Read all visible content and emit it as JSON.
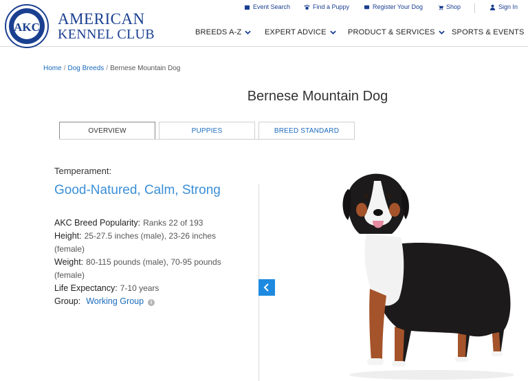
{
  "brand": {
    "line1": "AMERICAN",
    "line2": "KENNEL CLUB",
    "logo_text": "AKC"
  },
  "utility_nav": [
    {
      "label": "Event Search",
      "icon": "event-icon"
    },
    {
      "label": "Find a Puppy",
      "icon": "paw-icon"
    },
    {
      "label": "Register Your Dog",
      "icon": "register-icon"
    },
    {
      "label": "Shop",
      "icon": "cart-icon"
    },
    {
      "label": "Sign In",
      "icon": "user-icon"
    }
  ],
  "main_nav": [
    {
      "label": "BREEDS A-Z"
    },
    {
      "label": "EXPERT ADVICE"
    },
    {
      "label": "PRODUCT & SERVICES"
    },
    {
      "label": "SPORTS & EVENTS"
    }
  ],
  "breadcrumb": {
    "home": "Home",
    "breeds": "Dog Breeds",
    "current": "Bernese Mountain Dog",
    "separator": "/"
  },
  "page_title": "Bernese Mountain Dog",
  "tabs": [
    {
      "label": "OVERVIEW",
      "active": true
    },
    {
      "label": "PUPPIES",
      "active": false
    },
    {
      "label": "BREED STANDARD",
      "active": false
    }
  ],
  "temperament": {
    "label": "Temperament:",
    "value": "Good-Natured, Calm, Strong"
  },
  "facts": {
    "popularity": {
      "label": "AKC Breed Popularity:",
      "value": "Ranks 22 of 193"
    },
    "height": {
      "label": "Height:",
      "value": "25-27.5 inches (male), 23-26 inches (female)"
    },
    "weight": {
      "label": "Weight:",
      "value": "80-115 pounds (male), 70-95 pounds (female)"
    },
    "life": {
      "label": "Life Expectancy:",
      "value": "7-10 years"
    },
    "group": {
      "label": "Group:",
      "value": "Working Group"
    }
  },
  "colors": {
    "brand_blue": "#1a3f90",
    "link_blue": "#1a6bbd",
    "accent_blue": "#3a8fd8",
    "button_blue": "#1d8ae0"
  }
}
